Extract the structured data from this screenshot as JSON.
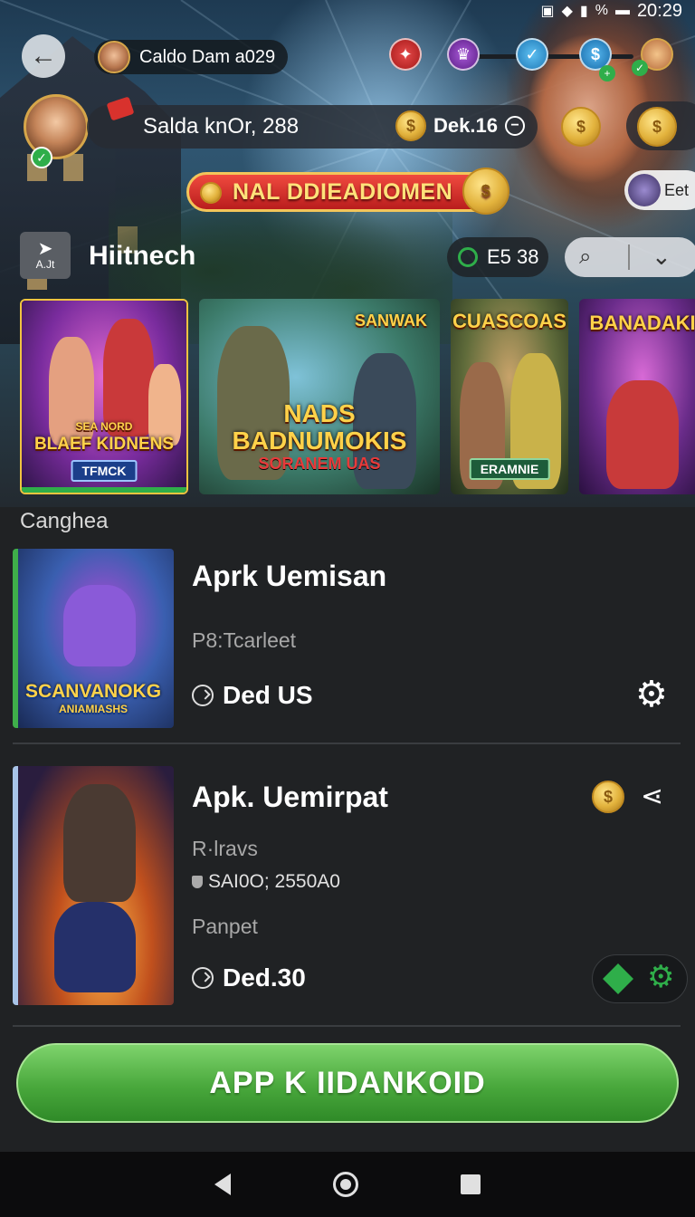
{
  "status_bar": {
    "time": "20:29",
    "signal_text": "%"
  },
  "header": {
    "back_icon": "arrow-left-icon",
    "profile_name": "Caldo Dam a029",
    "balance_text": "Salda knOr, 288",
    "currency_label": "Dek.16",
    "promo_banner": "NAL DDIEADIOMEN",
    "user_chip": "Eet"
  },
  "section": {
    "icon_label": "A.Jt",
    "title": "Hiitnech",
    "timer": "E5 38"
  },
  "carousel": [
    {
      "title_small": "SEA NORD",
      "title": "BLAEF KIDNENS",
      "tag": "TFMCK"
    },
    {
      "title_top": "SANWAK",
      "title": "NADS BADNUMOKIS",
      "subtitle": "SORANEM UAS"
    },
    {
      "title": "CUASCOAS",
      "tag": "ERAMNIE"
    },
    {
      "title": "BANADAKI"
    }
  ],
  "category_label": "Canghea",
  "items": [
    {
      "title": "Aprk Uemisan",
      "subtitle": "P8:Tcarleet",
      "meta": "Ded US",
      "thumb_title": "SCANVANOKG",
      "thumb_subtitle": "ANIAMIASHS"
    },
    {
      "title": "Apk. Uemirpat",
      "line1": "R·lravs",
      "line2": "SAI0O; 2550A0",
      "line3": "Panpet",
      "meta": "Ded.30"
    }
  ],
  "cta_label": "APP K IIDANKOID",
  "colors": {
    "accent_green": "#49a83c",
    "promo_red": "#d8322d",
    "gold": "#e2b23c"
  }
}
